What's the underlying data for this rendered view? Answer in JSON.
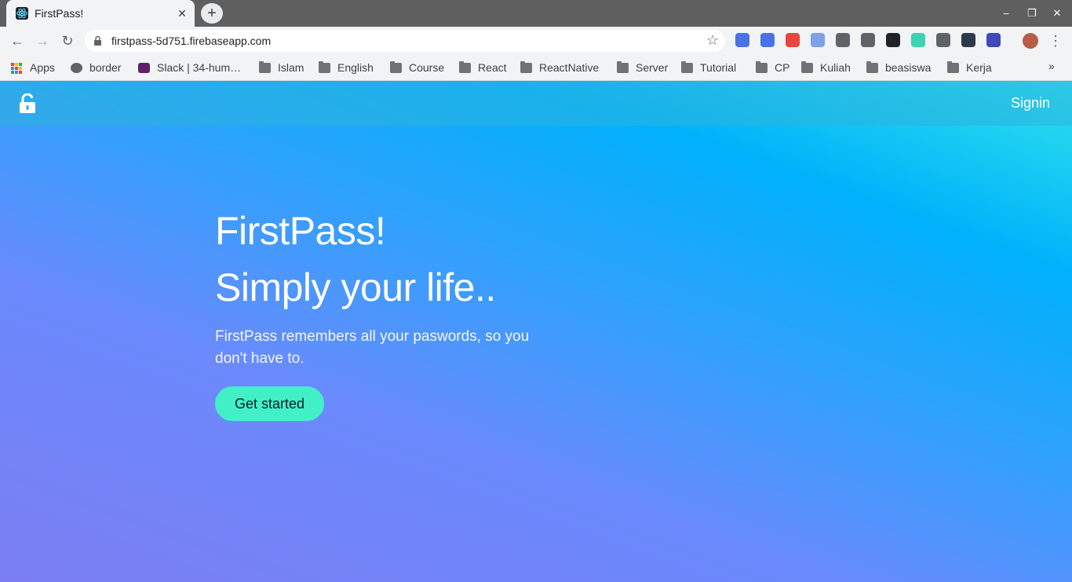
{
  "browser": {
    "tab_title": "FirstPass!",
    "tab_close": "✕",
    "new_tab": "+",
    "url": "firstpass-5d751.firebaseapp.com",
    "window_controls": {
      "minimize": "–",
      "maximize": "❐",
      "close": "✕"
    },
    "nav": {
      "back": "←",
      "forward": "→",
      "reload": "↻"
    },
    "star": "☆",
    "menu": "⋮",
    "extensions": [
      "#4a72e8",
      "#4a72e8",
      "#e8453c",
      "#7ea1e8",
      "#5f6368",
      "#5f6368",
      "#20232a",
      "#3bd3b0",
      "#5f6368",
      "#2d3a4b",
      "#3d4ab8"
    ]
  },
  "bookmarks": {
    "items": [
      {
        "label": "Apps",
        "icon": "apps-grid-icon"
      },
      {
        "label": "border",
        "icon": "globe-icon"
      },
      {
        "label": "Slack | 34-hum…",
        "icon": "slack-icon"
      },
      {
        "label": "Islam",
        "icon": "folder-icon"
      },
      {
        "label": "English",
        "icon": "folder-icon"
      },
      {
        "label": "Course",
        "icon": "folder-icon"
      },
      {
        "label": "React",
        "icon": "folder-icon"
      },
      {
        "label": "ReactNative",
        "icon": "folder-icon"
      },
      {
        "label": "Server",
        "icon": "folder-icon"
      },
      {
        "label": "Tutorial",
        "icon": "folder-icon"
      },
      {
        "label": "CP",
        "icon": "folder-icon"
      },
      {
        "label": "Kuliah",
        "icon": "folder-icon"
      },
      {
        "label": "beasiswa",
        "icon": "folder-icon"
      },
      {
        "label": "Kerja",
        "icon": "folder-icon"
      }
    ],
    "overflow": "»"
  },
  "page": {
    "navbar": {
      "signin": "Signin"
    },
    "hero": {
      "title": "FirstPass!",
      "tagline": "Simply your life..",
      "description": "FirstPass remembers all your paswords, so you don't have to.",
      "cta": "Get started"
    },
    "colors": {
      "gradient_top": "#2ee3ec",
      "gradient_mid": "#2da2fc",
      "gradient_bottom": "#7b7ef2",
      "cta": "#42f0c8"
    }
  }
}
